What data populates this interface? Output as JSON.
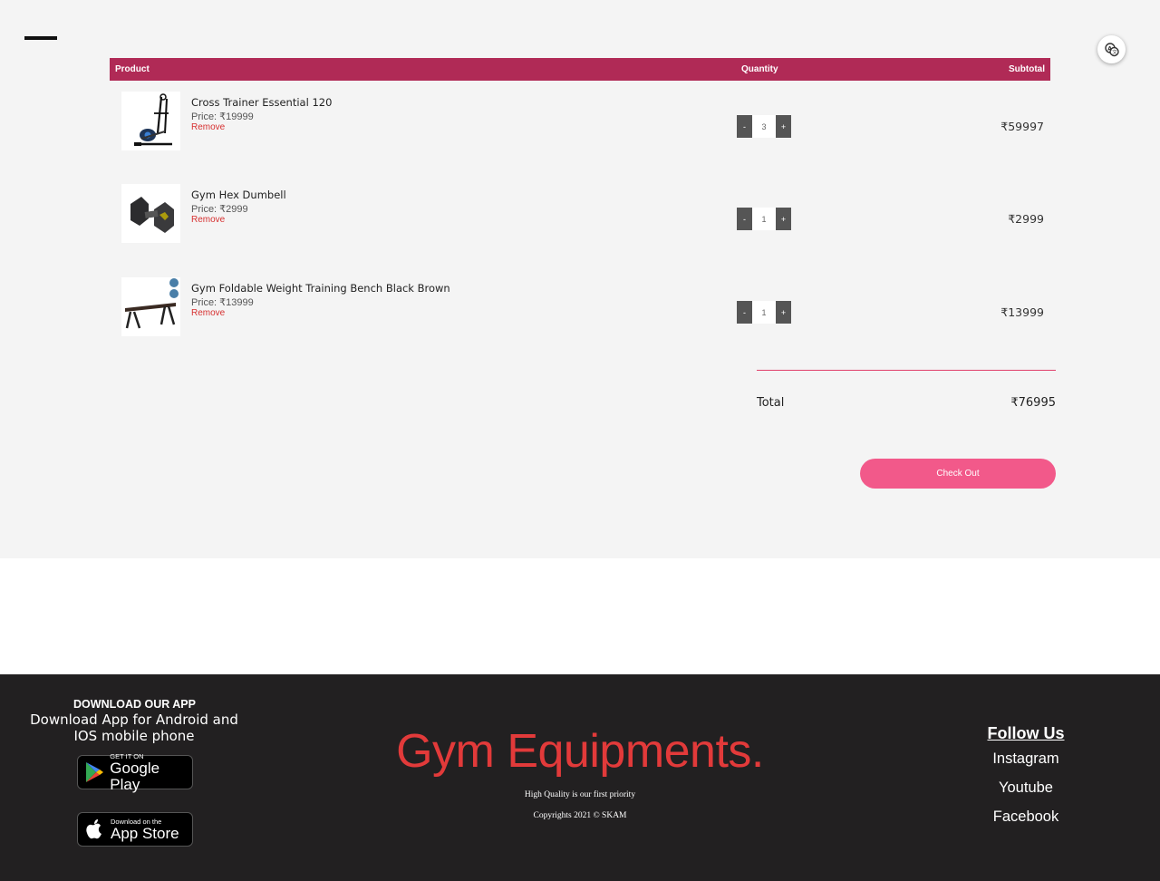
{
  "header": {
    "menu_icon": "hamburger-menu-icon",
    "language_icon": "translate-icon"
  },
  "cart": {
    "columns": {
      "product": "Product",
      "quantity": "Quantity",
      "subtotal": "Subtotal"
    },
    "items": [
      {
        "name": "Cross Trainer Essential 120",
        "price": "Price: ₹19999",
        "remove": "Remove",
        "qty_minus": "-",
        "qty": "3",
        "qty_plus": "+",
        "subtotal": "₹59997",
        "image": "cross-trainer-image"
      },
      {
        "name": "Gym Hex Dumbell",
        "price": "Price: ₹2999",
        "remove": "Remove",
        "qty_minus": "-",
        "qty": "1",
        "qty_plus": "+",
        "subtotal": "₹2999",
        "image": "hex-dumbbell-image"
      },
      {
        "name": "Gym Foldable Weight Training Bench Black Brown",
        "price": "Price: ₹13999",
        "remove": "Remove",
        "qty_minus": "-",
        "qty": "1",
        "qty_plus": "+",
        "subtotal": "₹13999",
        "image": "weight-bench-image"
      }
    ],
    "total_label": "Total",
    "total_value": "₹76995",
    "checkout_label": "Check Out"
  },
  "footer": {
    "download_title": "DOWNLOAD OUR APP",
    "download_text": "Download App for Android and IOS mobile phone",
    "google_play": {
      "small": "GET IT ON",
      "big": "Google Play"
    },
    "app_store": {
      "small": "Download on the",
      "big": "App Store"
    },
    "brand": "Gym Equipments.",
    "tagline": "High Quality is our first priority",
    "copyright": "Copyrights 2021 © SKAM",
    "follow_title": "Follow Us",
    "social": [
      "Instagram",
      "Youtube",
      "Facebook"
    ]
  },
  "colors": {
    "header_bar": "#b02a56",
    "checkout_button": "#f2598a",
    "brand_red": "#e23a3a",
    "footer_bg": "#222021"
  }
}
